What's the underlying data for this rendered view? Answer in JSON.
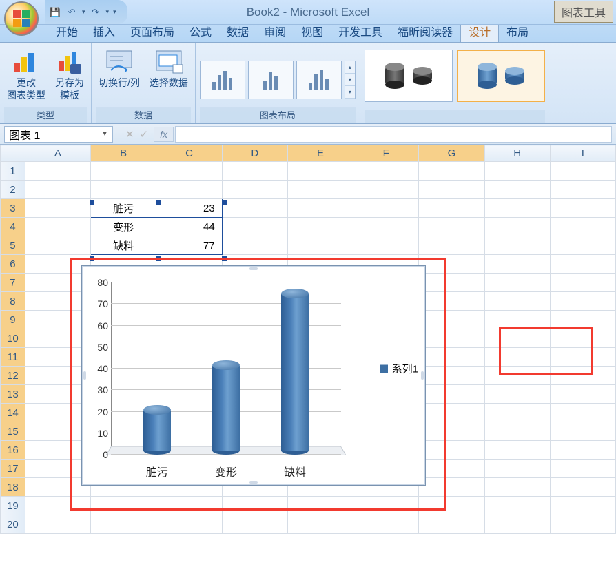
{
  "titlebar": {
    "title": "Book2 - Microsoft Excel",
    "tool_tab": "图表工具"
  },
  "qat": {
    "save": "save-icon",
    "undo": "undo-icon",
    "redo": "redo-icon"
  },
  "ribbon_tabs": [
    "开始",
    "插入",
    "页面布局",
    "公式",
    "数据",
    "审阅",
    "视图",
    "开发工具",
    "福昕阅读器",
    "设计",
    "布局"
  ],
  "ribbon_active_tab": "设计",
  "ribbon": {
    "group_type_label": "类型",
    "group_data_label": "数据",
    "group_layout_label": "图表布局",
    "btn_change_type_l1": "更改",
    "btn_change_type_l2": "图表类型",
    "btn_save_tpl_l1": "另存为",
    "btn_save_tpl_l2": "模板",
    "btn_switch": "切换行/列",
    "btn_select_data": "选择数据"
  },
  "name_box": "图表 1",
  "columns": [
    "A",
    "B",
    "C",
    "D",
    "E",
    "F",
    "G",
    "H",
    "I"
  ],
  "rows": [
    "1",
    "2",
    "3",
    "4",
    "5",
    "6",
    "7",
    "8",
    "9",
    "10",
    "11",
    "12",
    "13",
    "14",
    "15",
    "16",
    "17",
    "18",
    "19",
    "20"
  ],
  "cells": {
    "B3": "脏污",
    "C3": "23",
    "B4": "变形",
    "C4": "44",
    "B5": "缺料",
    "C5": "77"
  },
  "legend_label": "系列1",
  "chart_data": {
    "type": "bar",
    "categories": [
      "脏污",
      "变形",
      "缺料"
    ],
    "values": [
      23,
      44,
      77
    ],
    "series_name": "系列1",
    "ylim": [
      0,
      80
    ],
    "yticks": [
      0,
      10,
      20,
      30,
      40,
      50,
      60,
      70,
      80
    ],
    "title": "",
    "xlabel": "",
    "ylabel": ""
  }
}
